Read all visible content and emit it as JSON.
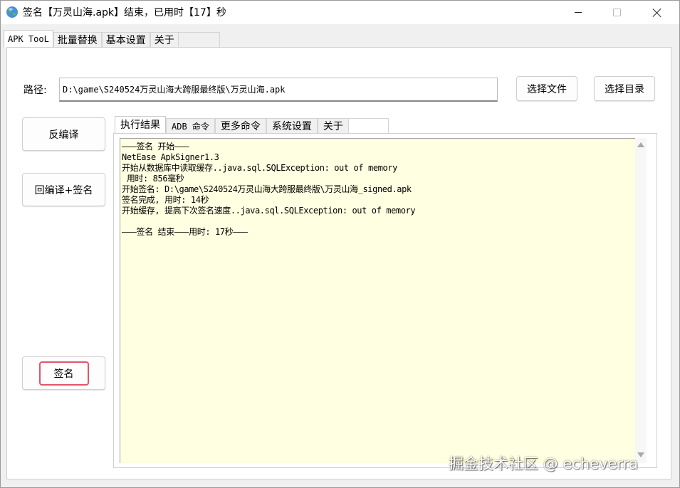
{
  "window": {
    "title": "签名【万灵山海.apk】结束，已用时【17】秒",
    "icon": "globe-icon"
  },
  "main_tabs": [
    {
      "label": "APK TooL",
      "active": true
    },
    {
      "label": "批量替换",
      "active": false
    },
    {
      "label": "基本设置",
      "active": false
    },
    {
      "label": "关于",
      "active": false
    }
  ],
  "path": {
    "label": "路径:",
    "value": "D:\\game\\S240524万灵山海大跨服最终版\\万灵山海.apk"
  },
  "buttons": {
    "choose_file": "选择文件",
    "choose_dir": "选择目录",
    "decompile": "反编译",
    "recompile_sign": "回编译+签名",
    "sign": "签名"
  },
  "sub_tabs": [
    {
      "label": "执行结果",
      "active": true
    },
    {
      "label": "ADB 命令",
      "active": false
    },
    {
      "label": "更多命令",
      "active": false
    },
    {
      "label": "系统设置",
      "active": false
    },
    {
      "label": "关于",
      "active": false
    }
  ],
  "output": [
    "———签名 开始———",
    "NetEase ApkSigner1.3",
    "开始从数据库中读取缓存..java.sql.SQLException: out of memory",
    " 用时: 856毫秒",
    "开始签名: D:\\game\\S240524万灵山海大跨服最终版\\万灵山海_signed.apk",
    "签名完成, 用时: 14秒",
    "开始缓存, 提高下次签名速度..java.sql.SQLException: out of memory",
    "",
    "———签名 结束———用时: 17秒———"
  ],
  "watermark": "掘金技术社区 @ echeverra",
  "colors": {
    "output_background": "#ffffe1",
    "sign_button_highlight": "#e0556c"
  }
}
